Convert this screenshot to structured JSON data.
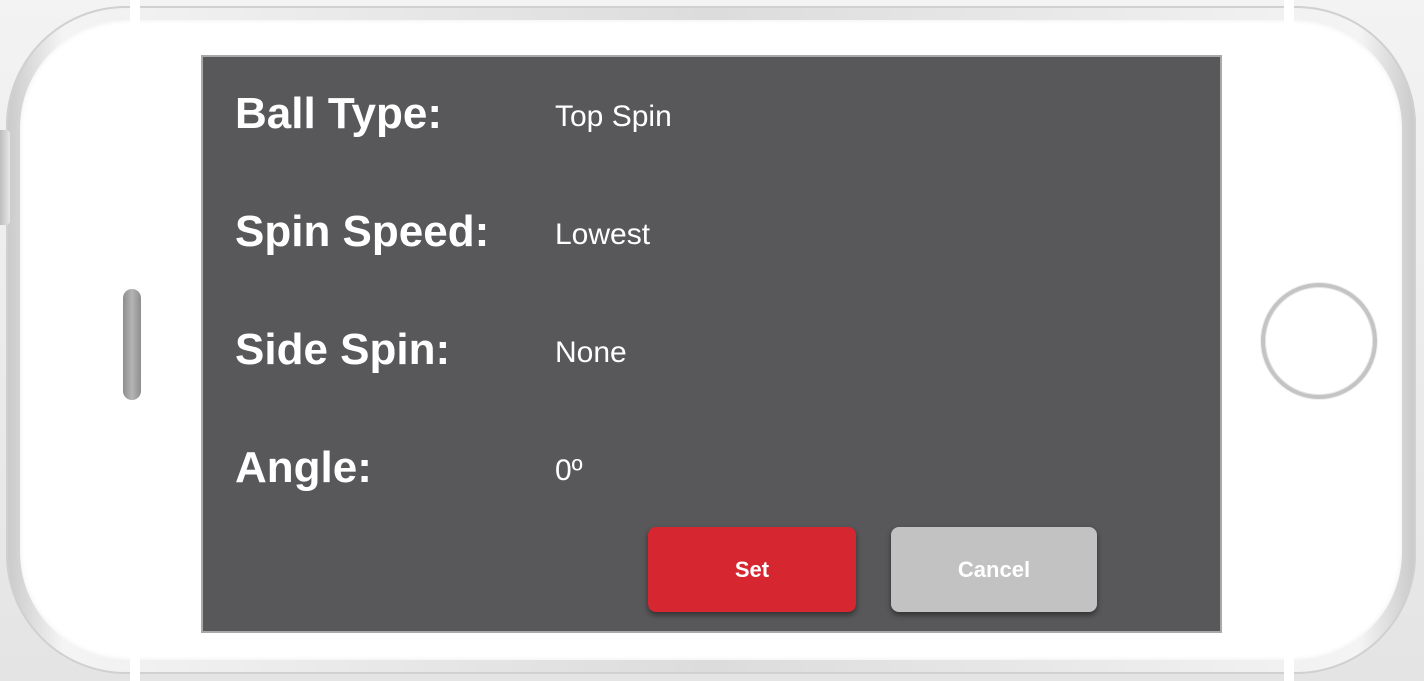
{
  "settings": {
    "ball_type": {
      "label": "Ball Type:",
      "value": "Top Spin"
    },
    "spin_speed": {
      "label": "Spin Speed:",
      "value": "Lowest"
    },
    "side_spin": {
      "label": "Side Spin:",
      "value": "None"
    },
    "angle": {
      "label": "Angle:",
      "value": "0º"
    }
  },
  "actions": {
    "set_label": "Set",
    "cancel_label": "Cancel"
  },
  "colors": {
    "screen_background": "#58585a",
    "set_button": "#d6262f",
    "cancel_button": "#c2c2c2",
    "text": "#ffffff"
  }
}
